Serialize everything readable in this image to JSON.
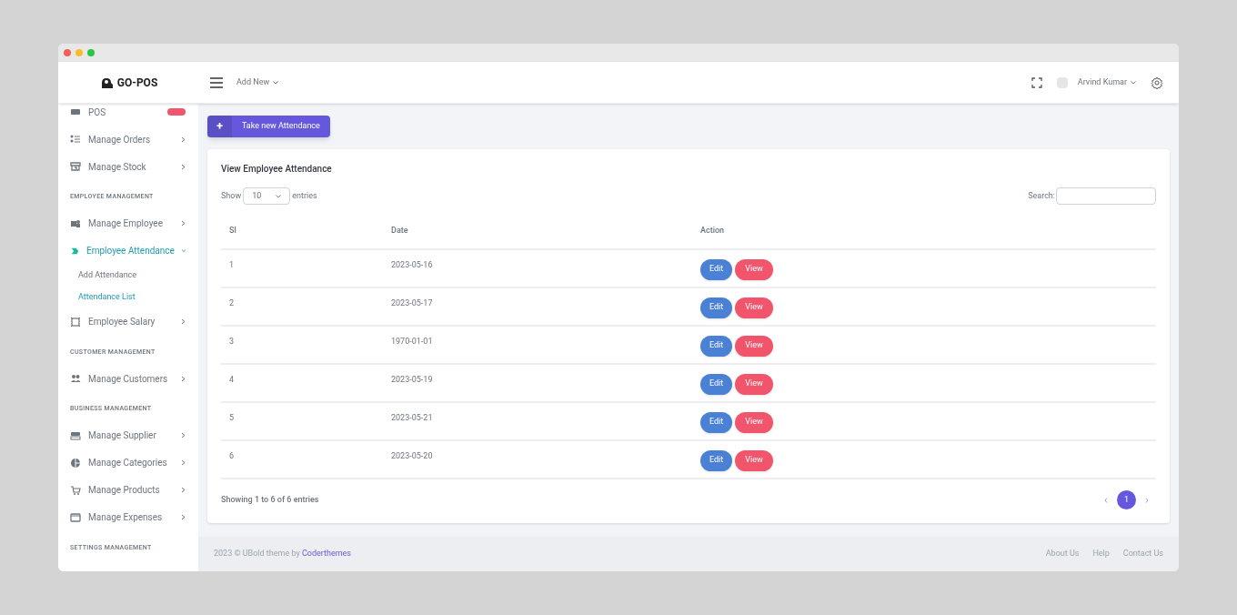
{
  "header": {
    "logo": "GO-POS",
    "add_new": "Add New",
    "user": "Arvind Kumar"
  },
  "sidebar": {
    "items": [
      {
        "kind": "item",
        "label": "POS",
        "badge": true,
        "expanded": false
      },
      {
        "kind": "item",
        "label": "Manage Orders",
        "expanded": false
      },
      {
        "kind": "item",
        "label": "Manage Stock",
        "expanded": false
      },
      {
        "kind": "heading",
        "label": "EMPLOYEE MANAGEMENT"
      },
      {
        "kind": "item",
        "label": "Manage Employee",
        "expanded": false
      },
      {
        "kind": "item",
        "label": "Employee Attendance",
        "expanded": true,
        "children": [
          {
            "label": "Add Attendance",
            "selected": false
          },
          {
            "label": "Attendance List",
            "selected": true
          }
        ]
      },
      {
        "kind": "item",
        "label": "Employee Salary",
        "expanded": false
      },
      {
        "kind": "heading",
        "label": "CUSTOMER MANAGEMENT"
      },
      {
        "kind": "item",
        "label": "Manage Customers",
        "expanded": false
      },
      {
        "kind": "heading",
        "label": "BUSINESS MANAGEMENT"
      },
      {
        "kind": "item",
        "label": "Manage Supplier",
        "expanded": false
      },
      {
        "kind": "item",
        "label": "Manage Categories",
        "expanded": false
      },
      {
        "kind": "item",
        "label": "Manage Products",
        "expanded": false
      },
      {
        "kind": "item",
        "label": "Manage Expenses",
        "expanded": false
      },
      {
        "kind": "heading",
        "label": "SETTINGS MANAGEMENT"
      }
    ]
  },
  "take_button": {
    "icon": "+",
    "label": "Take new Attendance"
  },
  "card": {
    "title": "View Employee Attendance",
    "show_label": "Show",
    "page_size": "10",
    "entries_label": "entries",
    "search_label": "Search:",
    "table": {
      "columns": [
        "Sl",
        "Date",
        "Action"
      ],
      "rows": [
        {
          "sl": "1",
          "date": "2023-05-16",
          "edit": "Edit",
          "view": "View"
        },
        {
          "sl": "2",
          "date": "2023-05-17",
          "edit": "Edit",
          "view": "View"
        },
        {
          "sl": "3",
          "date": "1970-01-01",
          "edit": "Edit",
          "view": "View"
        },
        {
          "sl": "4",
          "date": "2023-05-19",
          "edit": "Edit",
          "view": "View"
        },
        {
          "sl": "5",
          "date": "2023-05-21",
          "edit": "Edit",
          "view": "View"
        },
        {
          "sl": "6",
          "date": "2023-05-20",
          "edit": "Edit",
          "view": "View"
        }
      ]
    },
    "info": "Showing 1 to 6 of 6 entries",
    "pages": [
      {
        "label": "1",
        "selected": true
      }
    ]
  },
  "footer": {
    "copyright": "2023 © UBold theme by",
    "link": "Coderthemes",
    "links": [
      "About Us",
      "Help",
      "Contact Us"
    ]
  }
}
